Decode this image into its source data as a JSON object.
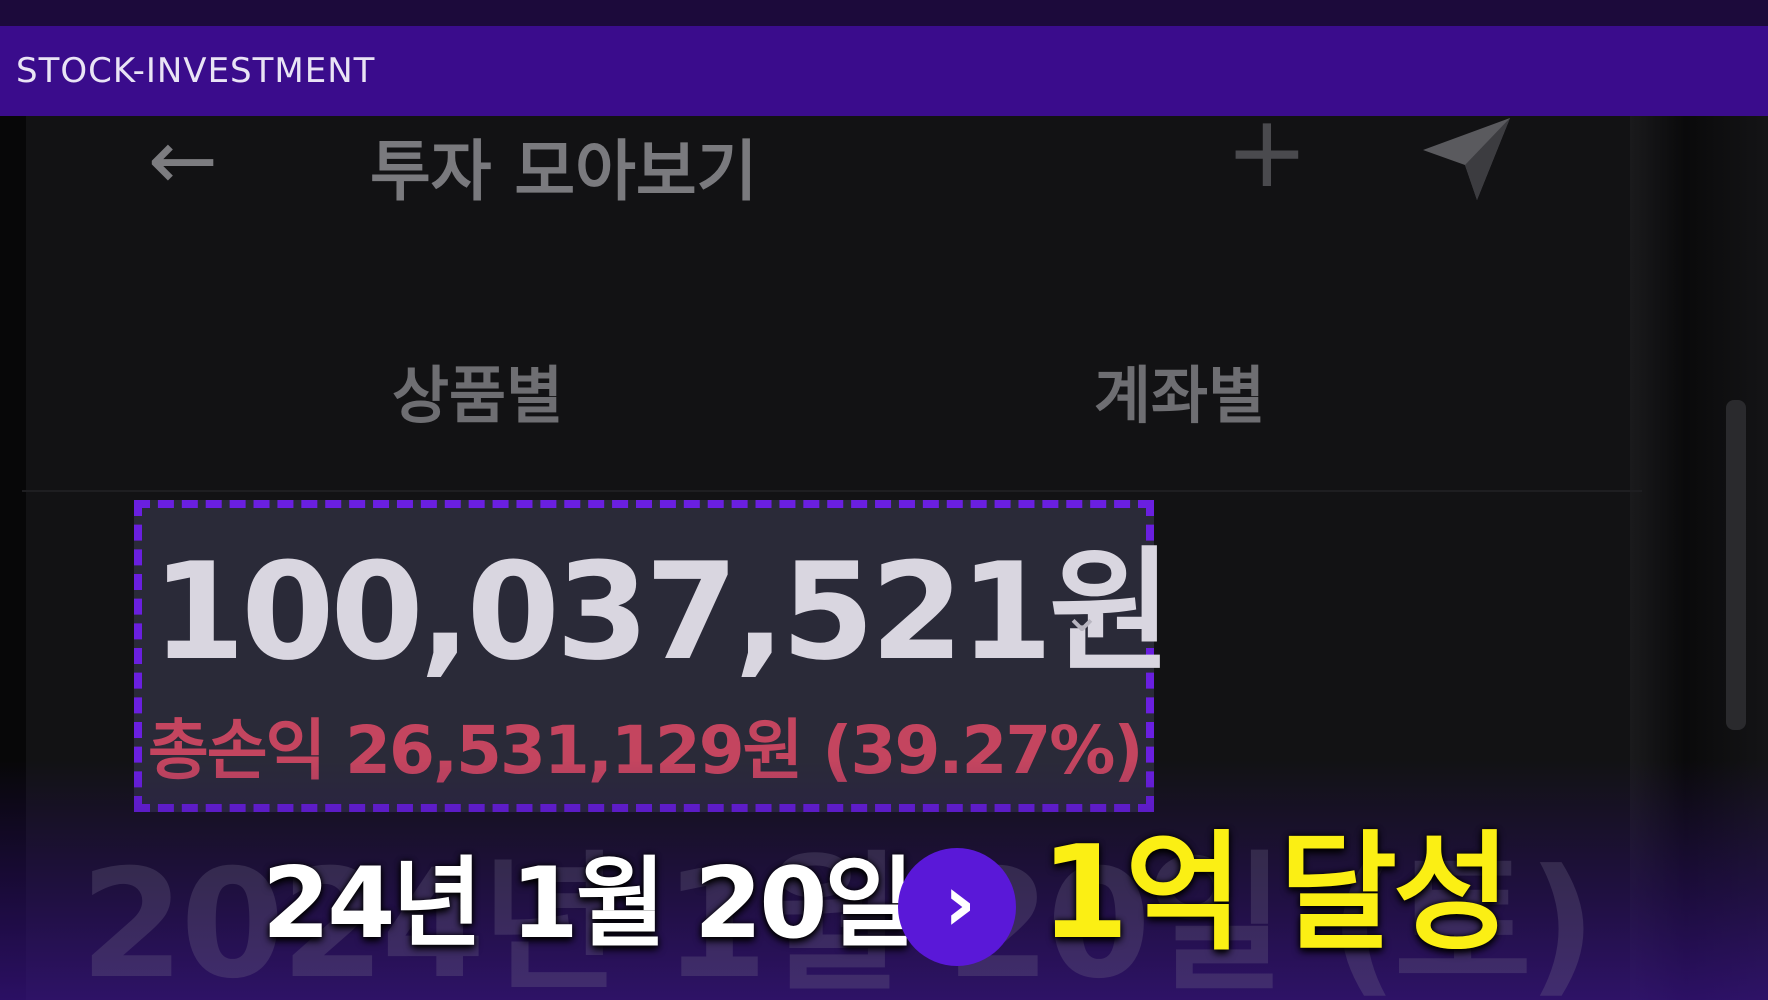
{
  "brand": {
    "label": "STOCK-INVESTMENT",
    "bar_color": "#3a0c8c"
  },
  "nav": {
    "back_icon": "arrow-left-icon",
    "title": "투자 모아보기",
    "plus_icon": "plus-icon",
    "send_icon": "send-icon"
  },
  "tabs": [
    {
      "label": "상품별"
    },
    {
      "label": "계좌별"
    }
  ],
  "summary": {
    "total_amount": "100,037,521원",
    "expand_icon": "chevron-down-icon",
    "profit": "총손익 26,531,129원 (39.27%)",
    "highlight_color": "#6a1fe0",
    "profit_color": "#c4455f"
  },
  "caption": {
    "ghost_text": "2024년 1월 20일 (토)",
    "date": "24년 1월 20일",
    "arrow_icon": "chevron-right-icon",
    "milestone": "1억 달성",
    "milestone_color": "#fbef14"
  }
}
